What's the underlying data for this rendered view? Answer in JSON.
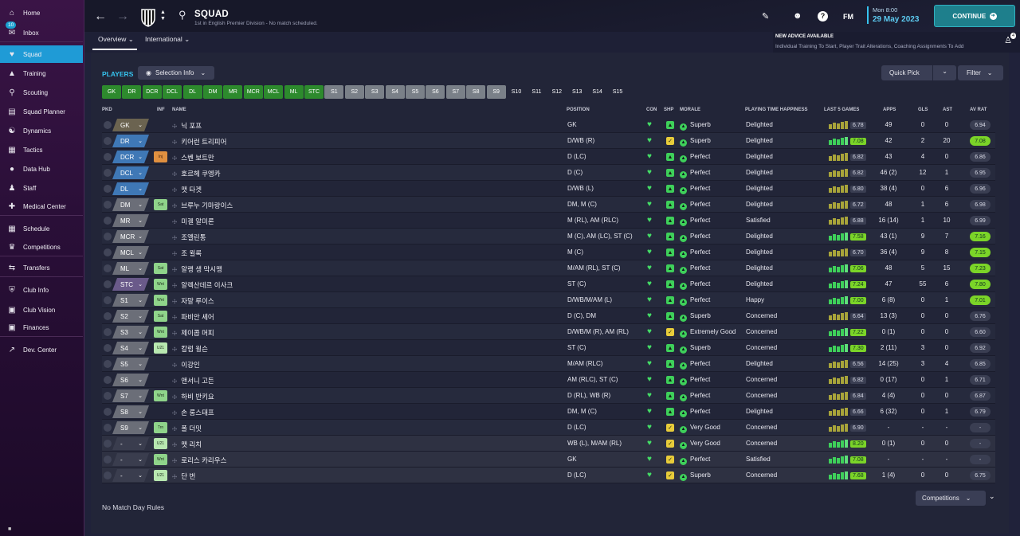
{
  "sidebar": {
    "items": [
      {
        "label": "Home",
        "icon": "home-icon"
      },
      {
        "label": "Inbox",
        "icon": "inbox-icon",
        "badge": "10"
      },
      {
        "label": "Squad",
        "icon": "shirt-icon"
      },
      {
        "label": "Training",
        "icon": "training-icon"
      },
      {
        "label": "Scouting",
        "icon": "scouting-icon"
      },
      {
        "label": "Squad Planner",
        "icon": "planner-icon"
      },
      {
        "label": "Dynamics",
        "icon": "dynamics-icon"
      },
      {
        "label": "Tactics",
        "icon": "tactics-icon"
      },
      {
        "label": "Data Hub",
        "icon": "datahub-icon"
      },
      {
        "label": "Staff",
        "icon": "staff-icon"
      },
      {
        "label": "Medical Center",
        "icon": "medical-icon"
      },
      {
        "label": "Schedule",
        "icon": "schedule-icon"
      },
      {
        "label": "Competitions",
        "icon": "trophy-icon"
      },
      {
        "label": "Transfers",
        "icon": "transfers-icon"
      },
      {
        "label": "Club Info",
        "icon": "club-info-icon"
      },
      {
        "label": "Club Vision",
        "icon": "club-vision-icon"
      },
      {
        "label": "Finances",
        "icon": "finances-icon"
      },
      {
        "label": "Dev. Center",
        "icon": "dev-center-icon"
      }
    ]
  },
  "header": {
    "title": "SQUAD",
    "subtitle": "1st in English Premier Division - No match scheduled.",
    "tabs": [
      "Overview",
      "International"
    ],
    "logo": "FM",
    "date_line1": "Mon 8:00",
    "date_line2": "29 May 2023",
    "continue_label": "CONTINUE",
    "advice_title": "NEW ADVICE AVAILABLE",
    "advice_text": "Individual Training To Start, Player Trait Alterations, Coaching Assignments To Add",
    "advice_count": "4"
  },
  "players_panel": {
    "label": "PLAYERS",
    "selection_info": "Selection Info",
    "quick_pick": "Quick Pick",
    "filter": "Filter",
    "positions": [
      {
        "label": "GK",
        "kind": "g"
      },
      {
        "label": "DR",
        "kind": "g"
      },
      {
        "label": "DCR",
        "kind": "g"
      },
      {
        "label": "DCL",
        "kind": "g"
      },
      {
        "label": "DL",
        "kind": "g"
      },
      {
        "label": "DM",
        "kind": "g"
      },
      {
        "label": "MR",
        "kind": "g"
      },
      {
        "label": "MCR",
        "kind": "g"
      },
      {
        "label": "MCL",
        "kind": "g"
      },
      {
        "label": "ML",
        "kind": "g"
      },
      {
        "label": "STC",
        "kind": "g"
      },
      {
        "label": "S1",
        "kind": "s"
      },
      {
        "label": "S2",
        "kind": "s"
      },
      {
        "label": "S3",
        "kind": "s"
      },
      {
        "label": "S4",
        "kind": "s"
      },
      {
        "label": "S5",
        "kind": "s"
      },
      {
        "label": "S6",
        "kind": "s"
      },
      {
        "label": "S7",
        "kind": "s"
      },
      {
        "label": "S8",
        "kind": "s"
      },
      {
        "label": "S9",
        "kind": "s"
      },
      {
        "label": "S10",
        "kind": "e"
      },
      {
        "label": "S11",
        "kind": "e"
      },
      {
        "label": "S12",
        "kind": "e"
      },
      {
        "label": "S13",
        "kind": "e"
      },
      {
        "label": "S14",
        "kind": "e"
      },
      {
        "label": "S15",
        "kind": "e"
      }
    ],
    "columns": [
      "PKD",
      "INF",
      "NAME",
      "POSITION",
      "CON",
      "SHP",
      "MORALE",
      "PLAYING TIME HAPPINESS",
      "LAST 5 GAMES",
      "APPS",
      "GLS",
      "AST",
      "AV RAT"
    ],
    "players": [
      {
        "pkd": "GK",
        "pkd_color": "#6b6350",
        "inf": "",
        "name": "닉 포프",
        "position": "GK",
        "shp": "g",
        "morale": "Superb",
        "happiness": "Delighted",
        "last5": "6.78",
        "last5_hi": false,
        "apps": "49",
        "gls": "0",
        "ast": "0",
        "avrat": "6.94",
        "avrat_hi": false
      },
      {
        "pkd": "DR",
        "pkd_color": "#3f78b6",
        "inf": "",
        "name": "키어런 트리피어",
        "position": "D/WB (R)",
        "shp": "y",
        "morale": "Superb",
        "happiness": "Delighted",
        "last5": "7.08",
        "last5_hi": true,
        "apps": "42",
        "gls": "2",
        "ast": "20",
        "avrat": "7.08",
        "avrat_hi": true
      },
      {
        "pkd": "DCR",
        "pkd_color": "#3f78b6",
        "inf": "Inj",
        "name": "스벤 보트만",
        "position": "D (LC)",
        "shp": "g",
        "morale": "Perfect",
        "happiness": "Delighted",
        "last5": "6.82",
        "last5_hi": false,
        "apps": "43",
        "gls": "4",
        "ast": "0",
        "avrat": "6.86",
        "avrat_hi": false
      },
      {
        "pkd": "DCL",
        "pkd_color": "#3f78b6",
        "inf": "",
        "name": "호르헤 쿠엥카",
        "position": "D (C)",
        "shp": "g",
        "morale": "Perfect",
        "happiness": "Delighted",
        "last5": "6.82",
        "last5_hi": false,
        "apps": "46 (2)",
        "gls": "12",
        "ast": "1",
        "avrat": "6.95",
        "avrat_hi": false
      },
      {
        "pkd": "DL",
        "pkd_color": "#3f78b6",
        "inf": "",
        "name": "맷 타겟",
        "position": "D/WB (L)",
        "shp": "g",
        "morale": "Perfect",
        "happiness": "Delighted",
        "last5": "6.80",
        "last5_hi": false,
        "apps": "38 (4)",
        "gls": "0",
        "ast": "6",
        "avrat": "6.96",
        "avrat_hi": false
      },
      {
        "pkd": "DM",
        "pkd_color": "#6b6e78",
        "inf": "Sat",
        "name": "브루누 기마랑이스",
        "position": "DM, M (C)",
        "shp": "g",
        "morale": "Perfect",
        "happiness": "Delighted",
        "last5": "6.72",
        "last5_hi": false,
        "apps": "48",
        "gls": "1",
        "ast": "6",
        "avrat": "6.98",
        "avrat_hi": false
      },
      {
        "pkd": "MR",
        "pkd_color": "#6b6e78",
        "inf": "",
        "name": "미겔 알미론",
        "position": "M (RL), AM (RLC)",
        "shp": "g",
        "morale": "Perfect",
        "happiness": "Satisfied",
        "last5": "6.88",
        "last5_hi": false,
        "apps": "16 (14)",
        "gls": "1",
        "ast": "10",
        "avrat": "6.99",
        "avrat_hi": false
      },
      {
        "pkd": "MCR",
        "pkd_color": "#6b6e78",
        "inf": "",
        "name": "조엘린통",
        "position": "M (C), AM (LC), ST (C)",
        "shp": "g",
        "morale": "Perfect",
        "happiness": "Delighted",
        "last5": "7.58",
        "last5_hi": true,
        "apps": "43 (1)",
        "gls": "9",
        "ast": "7",
        "avrat": "7.16",
        "avrat_hi": true
      },
      {
        "pkd": "MCL",
        "pkd_color": "#6b6e78",
        "inf": "",
        "name": "조 윌록",
        "position": "M (C)",
        "shp": "g",
        "morale": "Perfect",
        "happiness": "Delighted",
        "last5": "6.70",
        "last5_hi": false,
        "apps": "36 (4)",
        "gls": "9",
        "ast": "8",
        "avrat": "7.15",
        "avrat_hi": true
      },
      {
        "pkd": "ML",
        "pkd_color": "#6b6e78",
        "inf": "Sat",
        "name": "알랭 생 막시맹",
        "position": "M/AM (RL), ST (C)",
        "shp": "g",
        "morale": "Perfect",
        "happiness": "Delighted",
        "last5": "7.06",
        "last5_hi": true,
        "apps": "48",
        "gls": "5",
        "ast": "15",
        "avrat": "7.23",
        "avrat_hi": true
      },
      {
        "pkd": "STC",
        "pkd_color": "#6a5a8a",
        "inf": "Wnt",
        "name": "알렉산데르 이사크",
        "position": "ST (C)",
        "shp": "g",
        "morale": "Perfect",
        "happiness": "Delighted",
        "last5": "7.24",
        "last5_hi": true,
        "apps": "47",
        "gls": "55",
        "ast": "6",
        "avrat": "7.80",
        "avrat_hi": true
      },
      {
        "pkd": "S1",
        "pkd_color": "#6b6e78",
        "inf": "Wnt",
        "name": "자말 루이스",
        "position": "D/WB/M/AM (L)",
        "shp": "g",
        "morale": "Perfect",
        "happiness": "Happy",
        "last5": "7.00",
        "last5_hi": true,
        "apps": "6 (8)",
        "gls": "0",
        "ast": "1",
        "avrat": "7.01",
        "avrat_hi": true
      },
      {
        "pkd": "S2",
        "pkd_color": "#6b6e78",
        "inf": "Sat",
        "name": "파비안 셰어",
        "position": "D (C), DM",
        "shp": "g",
        "morale": "Superb",
        "happiness": "Concerned",
        "last5": "6.64",
        "last5_hi": false,
        "apps": "13 (3)",
        "gls": "0",
        "ast": "0",
        "avrat": "6.76",
        "avrat_hi": false
      },
      {
        "pkd": "S3",
        "pkd_color": "#6b6e78",
        "inf": "Wnt",
        "name": "제이콥 머피",
        "position": "D/WB/M (R), AM (RL)",
        "shp": "y",
        "morale": "Extremely Good",
        "happiness": "Concerned",
        "last5": "7.22",
        "last5_hi": true,
        "apps": "0 (1)",
        "gls": "0",
        "ast": "0",
        "avrat": "6.60",
        "avrat_hi": false
      },
      {
        "pkd": "S4",
        "pkd_color": "#6b6e78",
        "inf": "U21",
        "name": "칼럼 윌슨",
        "position": "ST (C)",
        "shp": "g",
        "morale": "Superb",
        "happiness": "Concerned",
        "last5": "7.30",
        "last5_hi": true,
        "apps": "2 (11)",
        "gls": "3",
        "ast": "0",
        "avrat": "6.92",
        "avrat_hi": false
      },
      {
        "pkd": "S5",
        "pkd_color": "#6b6e78",
        "inf": "",
        "name": "이강인",
        "position": "M/AM (RLC)",
        "shp": "g",
        "morale": "Perfect",
        "happiness": "Delighted",
        "last5": "6.56",
        "last5_hi": false,
        "apps": "14 (25)",
        "gls": "3",
        "ast": "4",
        "avrat": "6.85",
        "avrat_hi": false
      },
      {
        "pkd": "S6",
        "pkd_color": "#6b6e78",
        "inf": "",
        "name": "앤서니 고든",
        "position": "AM (RLC), ST (C)",
        "shp": "g",
        "morale": "Perfect",
        "happiness": "Concerned",
        "last5": "6.82",
        "last5_hi": false,
        "apps": "0 (17)",
        "gls": "0",
        "ast": "1",
        "avrat": "6.71",
        "avrat_hi": false
      },
      {
        "pkd": "S7",
        "pkd_color": "#6b6e78",
        "inf": "Wnt",
        "name": "하비 반키요",
        "position": "D (RL), WB (R)",
        "shp": "g",
        "morale": "Perfect",
        "happiness": "Concerned",
        "last5": "6.84",
        "last5_hi": false,
        "apps": "4 (4)",
        "gls": "0",
        "ast": "0",
        "avrat": "6.87",
        "avrat_hi": false
      },
      {
        "pkd": "S8",
        "pkd_color": "#6b6e78",
        "inf": "",
        "name": "손 롱스태프",
        "position": "DM, M (C)",
        "shp": "g",
        "morale": "Perfect",
        "happiness": "Delighted",
        "last5": "6.66",
        "last5_hi": false,
        "apps": "6 (32)",
        "gls": "0",
        "ast": "1",
        "avrat": "6.79",
        "avrat_hi": false
      },
      {
        "pkd": "S9",
        "pkd_color": "#6b6e78",
        "inf": "Trn",
        "name": "폴 더밋",
        "position": "D (LC)",
        "shp": "y",
        "morale": "Very Good",
        "happiness": "Concerned",
        "last5": "6.90",
        "last5_hi": false,
        "apps": "-",
        "gls": "-",
        "ast": "-",
        "avrat": "-",
        "avrat_hi": false
      },
      {
        "pkd": "-",
        "pkd_color": "#3a3d4e",
        "inf": "U21",
        "name": "맷 리치",
        "position": "WB (L), M/AM (RL)",
        "shp": "y",
        "morale": "Very Good",
        "happiness": "Concerned",
        "last5": "8.20",
        "last5_hi": true,
        "apps": "0 (1)",
        "gls": "0",
        "ast": "0",
        "avrat": "-",
        "avrat_hi": false
      },
      {
        "pkd": "-",
        "pkd_color": "#3a3d4e",
        "inf": "Wnt",
        "name": "로리스 카리우스",
        "position": "GK",
        "shp": "y",
        "morale": "Perfect",
        "happiness": "Satisfied",
        "last5": "7.08",
        "last5_hi": true,
        "apps": "-",
        "gls": "-",
        "ast": "-",
        "avrat": "-",
        "avrat_hi": false
      },
      {
        "pkd": "-",
        "pkd_color": "#3a3d4e",
        "inf": "U21",
        "name": "단 번",
        "position": "D (LC)",
        "shp": "y",
        "morale": "Superb",
        "happiness": "Concerned",
        "last5": "7.68",
        "last5_hi": true,
        "apps": "1 (4)",
        "gls": "0",
        "ast": "0",
        "avrat": "6.75",
        "avrat_hi": false
      }
    ],
    "competitions_label": "Competitions",
    "footer": "No Match Day Rules"
  }
}
